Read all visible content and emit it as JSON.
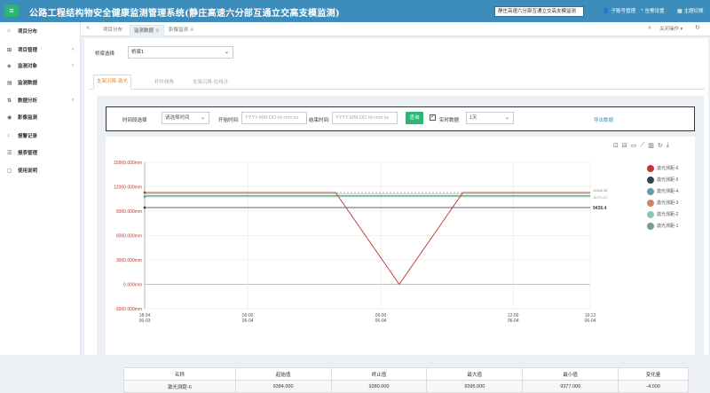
{
  "header": {
    "title": "公路工程结构物安全健康监测管理系统(静庄高速六分部互通立交高支模监测)",
    "project_select": "静庄高速六分部互通立交高支模监测",
    "links": [
      {
        "icon": "user-icon",
        "label": "子账号管理"
      },
      {
        "icon": "pie-icon",
        "label": "告警设置"
      },
      {
        "icon": "grid-icon",
        "label": "主题切换"
      }
    ]
  },
  "sidebar": {
    "items": [
      {
        "label": "项目分布",
        "icon": "home-icon",
        "has_arrow": false
      },
      {
        "label": "项目管理",
        "icon": "sitemap-icon",
        "has_arrow": true
      },
      {
        "label": "监测对象",
        "icon": "cube-icon",
        "has_arrow": true
      },
      {
        "label": "监测数据",
        "icon": "chart-icon",
        "has_arrow": false
      },
      {
        "label": "数据分析",
        "icon": "analysis-icon",
        "has_arrow": true
      },
      {
        "label": "影像监测",
        "icon": "camera-icon",
        "has_arrow": false
      },
      {
        "label": "报警记录",
        "icon": "bell-icon",
        "has_arrow": false
      },
      {
        "label": "报表管理",
        "icon": "report-icon",
        "has_arrow": false
      },
      {
        "label": "使用说明",
        "icon": "doc-icon",
        "has_arrow": false
      }
    ]
  },
  "tabbar": {
    "tabs": [
      {
        "label": "项目分布",
        "active": false,
        "closable": false
      },
      {
        "label": "监测数据",
        "active": true,
        "closable": true
      },
      {
        "label": "影像监测",
        "active": false,
        "closable": true
      }
    ],
    "close_ops": "关闭操作"
  },
  "main": {
    "bridge_label": "桥梁选择",
    "bridge_value": "桥梁1",
    "subtabs": [
      "支架沉降-激光",
      "杆件倾角",
      "支架沉降-拉线计"
    ],
    "filter": {
      "period_label": "时间段选择",
      "period_value": "请选择时间",
      "start_label": "开始时间:",
      "start_placeholder": "YYYY-MM-DD hh:mm:ss",
      "end_label": "结束时间:",
      "end_placeholder": "YYYY-MM-DD hh:mm:ss",
      "query_label": "查询",
      "realtime_label": "实时数据",
      "realtime_checked": true,
      "range_value": "1天",
      "export_label": "导出数据"
    },
    "toolbox_icons": [
      "zoom-icon",
      "zoom-reset-icon",
      "data-view-icon",
      "line-chart-icon",
      "bar-chart-icon",
      "restore-icon",
      "download-icon"
    ]
  },
  "chart_data": {
    "type": "line",
    "y_ticks": [
      "15000.000mm",
      "12000.000mm",
      "9000.000mm",
      "6000.000mm",
      "3000.000mm",
      "0.000mm",
      "-3000.000mm"
    ],
    "ylim": [
      -3000,
      15000
    ],
    "x_ticks": [
      {
        "time": "18:34",
        "date": "06-03"
      },
      {
        "time": "00:00",
        "date": "06-04"
      },
      {
        "time": "06:00",
        "date": "06-04"
      },
      {
        "time": "12:00",
        "date": "06-04"
      },
      {
        "time": "16:13",
        "date": "06-04"
      }
    ],
    "grid": true,
    "legend_position": "right",
    "markline_labels": [
      "11286.36",
      "10771.27",
      "9436.4"
    ],
    "series": [
      {
        "name": "激光测距-6",
        "color": "#c23531",
        "values": [
          11286,
          11286,
          11286,
          11286,
          0,
          11286,
          11286,
          11286
        ]
      },
      {
        "name": "激光测距-5",
        "color": "#2f4554",
        "values": [
          9436,
          9436,
          9436,
          9436,
          9436,
          9436,
          9436,
          9436
        ]
      },
      {
        "name": "激光测距-4",
        "color": "#61a0a8",
        "values": [
          10771,
          10771,
          10771,
          10771,
          10771,
          10771,
          10771,
          10771
        ]
      },
      {
        "name": "激光测距-3",
        "color": "#d48265",
        "values": [
          11286,
          11286,
          11286,
          11286,
          0,
          11286,
          11286,
          11286
        ]
      },
      {
        "name": "激光测距-2",
        "color": "#91c7ae",
        "values": [
          11100,
          11100,
          11100,
          11100,
          11100,
          11100,
          11100,
          11100
        ]
      },
      {
        "name": "激光测距-1",
        "color": "#749f83",
        "values": [
          10900,
          10900,
          10900,
          10900,
          10900,
          10900,
          10900,
          10900
        ]
      }
    ],
    "x_index_ticks": [
      0,
      1.62,
      3.71,
      5.79,
      7
    ]
  },
  "table": {
    "headers": [
      "名称",
      "起始值",
      "终止值",
      "最大值",
      "最小值",
      "变化量"
    ],
    "rows": [
      [
        "激光测距-6",
        "9384.000",
        "9380.000",
        "9395.000",
        "9377.000",
        "-4.000"
      ]
    ]
  }
}
